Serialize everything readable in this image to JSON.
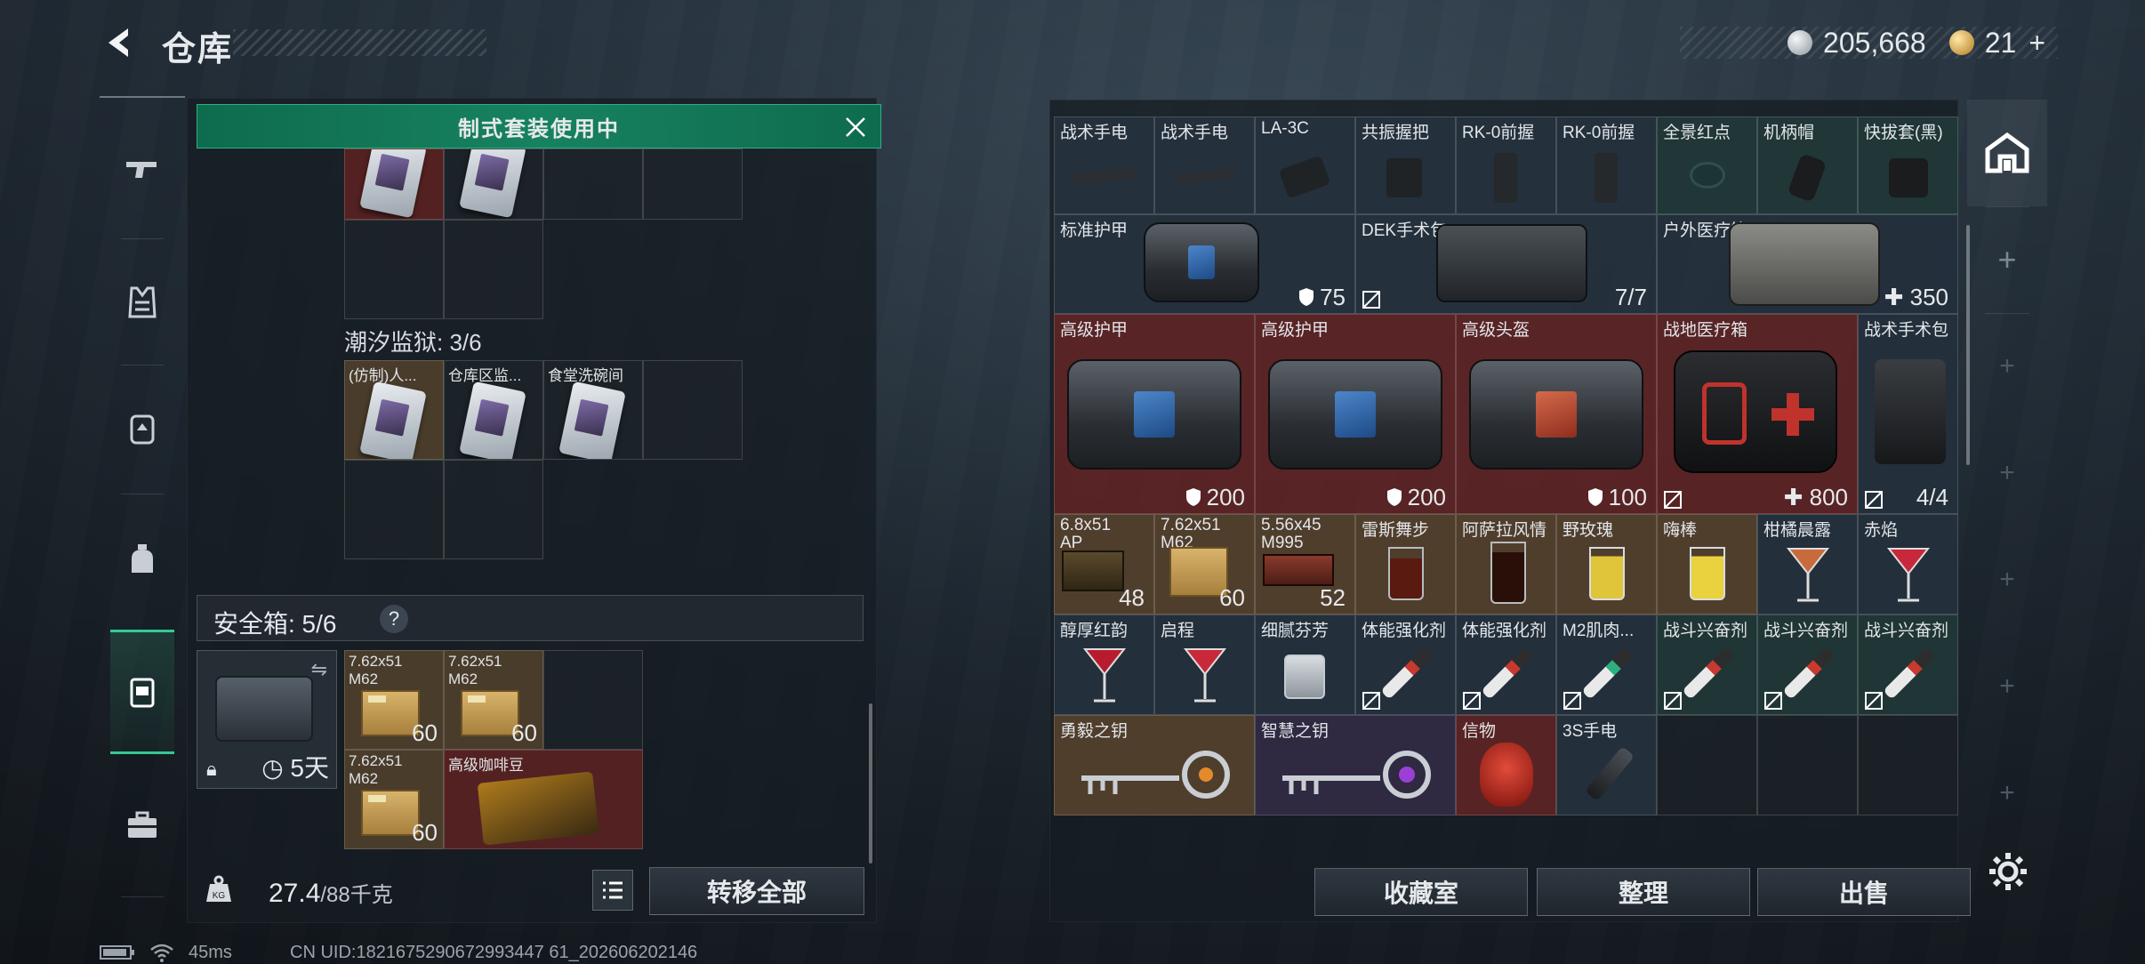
{
  "header": {
    "title": "仓库",
    "currency": [
      {
        "icon": "silver-coin-icon",
        "value": "205,668"
      },
      {
        "icon": "gold-coin-icon",
        "value": "21"
      }
    ],
    "add_symbol": "+"
  },
  "banner": {
    "text": "制式套装使用中"
  },
  "sections": {
    "prison_label": "潮汐监狱: 3/6",
    "prison_items": [
      "(仿制)人...",
      "仓库区监...",
      "食堂洗碗间"
    ]
  },
  "safebox": {
    "label": "安全箱: 5/6",
    "help": "?",
    "days": "5天",
    "items": [
      {
        "name": "7.62x51\nM62",
        "qty": "60"
      },
      {
        "name": "7.62x51\nM62",
        "qty": "60"
      },
      {
        "name": "7.62x51\nM62",
        "qty": "60"
      },
      {
        "name": "高级咖啡豆",
        "qty": ""
      }
    ]
  },
  "weight": {
    "value": "27.4",
    "capacity": "/88千克"
  },
  "buttons": {
    "transfer_all": "转移全部",
    "collection": "收藏室",
    "organize": "整理",
    "sell": "出售"
  },
  "stash": {
    "row1": [
      "战术手电",
      "战术手电",
      "LA-3C",
      "共振握把",
      "RK-0前握",
      "RK-0前握",
      "全景红点",
      "机柄帽",
      "快拔套(黑)"
    ],
    "row2": [
      {
        "name": "标准护甲",
        "value": "75"
      },
      {
        "name": "DEK手术包",
        "value": "7/7"
      },
      {
        "name": "户外医疗箱",
        "value": "350"
      }
    ],
    "row3": [
      {
        "name": "高级护甲",
        "value": "200"
      },
      {
        "name": "高级护甲",
        "value": "200"
      },
      {
        "name": "高级头盔",
        "value": "100"
      },
      {
        "name": "战地医疗箱",
        "value": "800"
      },
      {
        "name": "战术手术包",
        "value": "4/4"
      }
    ],
    "row4": [
      {
        "name": "6.8x51\nAP",
        "value": "48"
      },
      {
        "name": "7.62x51\nM62",
        "value": "60"
      },
      {
        "name": "5.56x45\nM995",
        "value": "52"
      },
      {
        "name": "雷斯舞步",
        "value": ""
      },
      {
        "name": "阿萨拉风情",
        "value": ""
      },
      {
        "name": "野玫瑰",
        "value": ""
      },
      {
        "name": "嗨棒",
        "value": ""
      },
      {
        "name": "柑橘晨露",
        "value": ""
      },
      {
        "name": "赤焰",
        "value": ""
      }
    ],
    "row5": [
      "醇厚红韵",
      "启程",
      "细腻芬芳",
      "体能强化剂",
      "体能强化剂",
      "M2肌肉...",
      "战斗兴奋剂",
      "战斗兴奋剂",
      "战斗兴奋剂"
    ],
    "row6": [
      "勇毅之钥",
      "智慧之钥",
      "信物",
      "3S手电"
    ]
  },
  "footer": {
    "ping": "45ms",
    "uid": "CN UID:1821675290672993447 61_202606202146"
  },
  "colors": {
    "accent": "#17825f",
    "highlight": "#35c995"
  }
}
